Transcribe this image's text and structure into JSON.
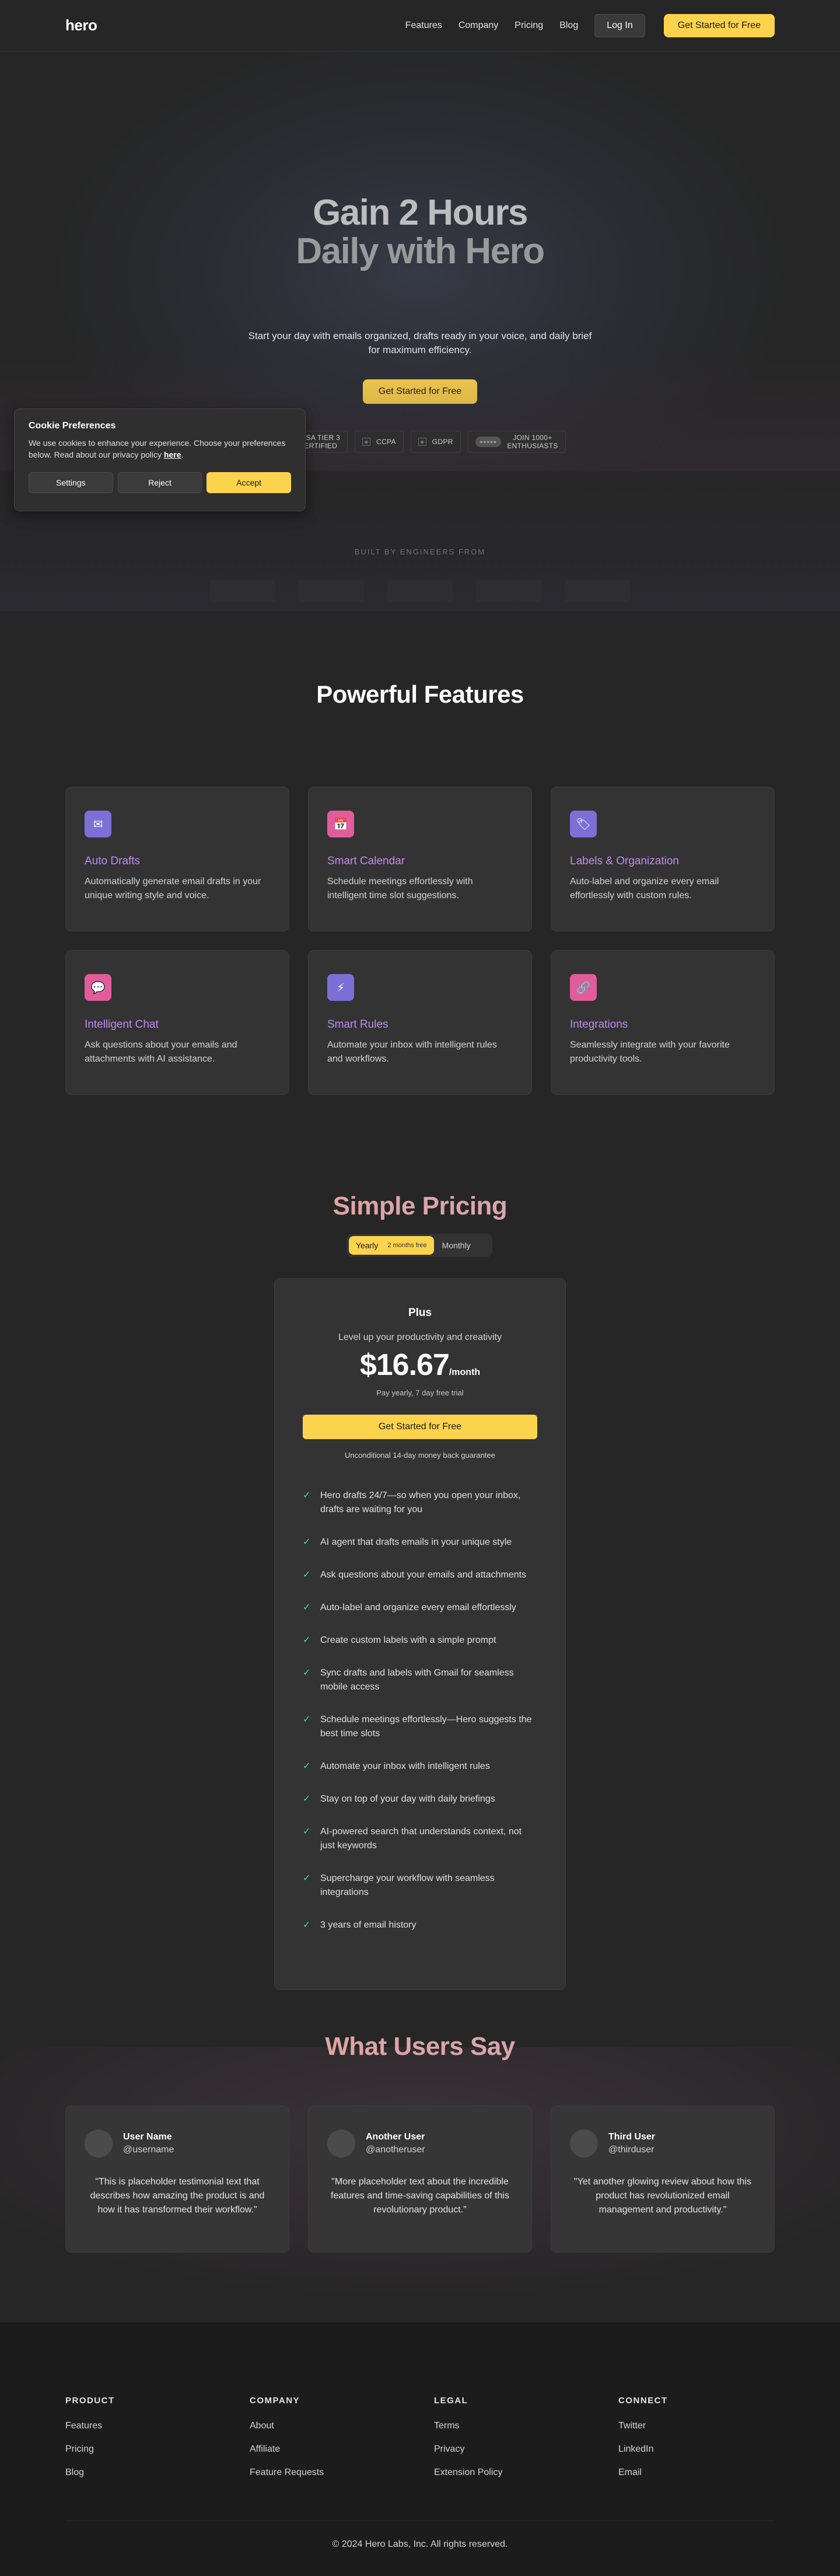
{
  "nav": {
    "logo": "hero",
    "links": [
      "Features",
      "Company",
      "Pricing",
      "Blog"
    ],
    "login": "Log In",
    "cta": "Get Started for Free"
  },
  "hero": {
    "title_line1": "Gain 2 Hours",
    "title_line2": "Daily with Hero",
    "subtitle": "Start your day with emails organized, drafts ready in your voice, and daily brief for maximum efficiency.",
    "cta": "Get Started for Free",
    "badges": [
      {
        "line1": "CASA TIER 3",
        "line2": "CERTIFIED"
      },
      {
        "line1": "CCPA",
        "line2": ""
      },
      {
        "line1": "GDPR",
        "line2": ""
      },
      {
        "line1": "JOIN 1000+",
        "line2": "ENTHUSIASTS"
      }
    ]
  },
  "engineers": {
    "label": "BUILT BY ENGINEERS FROM",
    "logos": [
      "",
      "",
      "",
      "",
      ""
    ]
  },
  "features": {
    "title": "Powerful Features",
    "items": [
      {
        "title": "Auto Drafts",
        "desc": "Automatically generate email drafts in your unique writing style and voice.",
        "icon": "envelope-icon",
        "glyph": "✉",
        "color": "#7c6fd6"
      },
      {
        "title": "Smart Calendar",
        "desc": "Schedule meetings effortlessly with intelligent time slot suggestions.",
        "icon": "calendar-icon",
        "glyph": "📅",
        "color": "#e05c9a"
      },
      {
        "title": "Labels & Organization",
        "desc": "Auto-label and organize every email effortlessly with custom rules.",
        "icon": "label-icon",
        "glyph": "🏷",
        "color": "#7c6fd6"
      },
      {
        "title": "Intelligent Chat",
        "desc": "Ask questions about your emails and attachments with AI assistance.",
        "icon": "chat-icon",
        "glyph": "💬",
        "color": "#e05c9a"
      },
      {
        "title": "Smart Rules",
        "desc": "Automate your inbox with intelligent rules and workflows.",
        "icon": "lightning-icon",
        "glyph": "⚡",
        "color": "#7c6fd6"
      },
      {
        "title": "Integrations",
        "desc": "Seamlessly integrate with your favorite productivity tools.",
        "icon": "link-icon",
        "glyph": "🔗",
        "color": "#e05c9a"
      }
    ]
  },
  "pricing": {
    "title": "Simple Pricing",
    "toggle_yearly": "Yearly",
    "toggle_badge": "2 months free",
    "toggle_monthly": "Monthly",
    "plan": {
      "name": "Plus",
      "desc": "Level up your productivity and creativity",
      "price": "$16.67",
      "period": "/month",
      "trial": "Pay yearly, 7 day free trial",
      "cta": "Get Started for Free",
      "guarantee": "Unconditional 14-day money back guarantee",
      "features": [
        "Hero drafts 24/7—so when you open your inbox, drafts are waiting for you",
        "AI agent that drafts emails in your unique style",
        "Ask questions about your emails and attachments",
        "Auto-label and organize every email effortlessly",
        "Create custom labels with a simple prompt",
        "Sync drafts and labels with Gmail for seamless mobile access",
        "Schedule meetings effortlessly—Hero suggests the best time slots",
        "Automate your inbox with intelligent rules",
        "Stay on top of your day with daily briefings",
        "AI-powered search that understands context, not just keywords",
        "Supercharge your workflow with seamless integrations",
        "3 years of email history"
      ]
    }
  },
  "testimonials": {
    "title": "What Users Say",
    "items": [
      {
        "name": "User Name",
        "handle": "@username",
        "quote": "\"This is placeholder testimonial text that describes how amazing the product is and how it has transformed their workflow.\""
      },
      {
        "name": "Another User",
        "handle": "@anotheruser",
        "quote": "\"More placeholder text about the incredible features and time-saving capabilities of this revolutionary product.\""
      },
      {
        "name": "Third User",
        "handle": "@thirduser",
        "quote": "\"Yet another glowing review about how this product has revolutionized email management and productivity.\""
      }
    ]
  },
  "footer": {
    "columns": [
      {
        "title": "PRODUCT",
        "links": [
          "Features",
          "Pricing",
          "Blog"
        ]
      },
      {
        "title": "COMPANY",
        "links": [
          "About",
          "Affiliate",
          "Feature Requests"
        ]
      },
      {
        "title": "LEGAL",
        "links": [
          "Terms",
          "Privacy",
          "Extension Policy"
        ]
      },
      {
        "title": "CONNECT",
        "links": [
          "Twitter",
          "LinkedIn",
          "Email"
        ]
      }
    ],
    "copyright": "© 2024 Hero Labs, Inc. All rights reserved."
  },
  "cookie": {
    "title": "Cookie Preferences",
    "text": "We use cookies to enhance your experience. Choose your preferences below. Read about our privacy policy",
    "link": "here",
    "after_link": ".",
    "settings": "Settings",
    "reject": "Reject",
    "accept": "Accept"
  },
  "colors": {
    "accent": "#fcd34d",
    "feature_title": "#c38af0",
    "check": "#4ade80"
  }
}
